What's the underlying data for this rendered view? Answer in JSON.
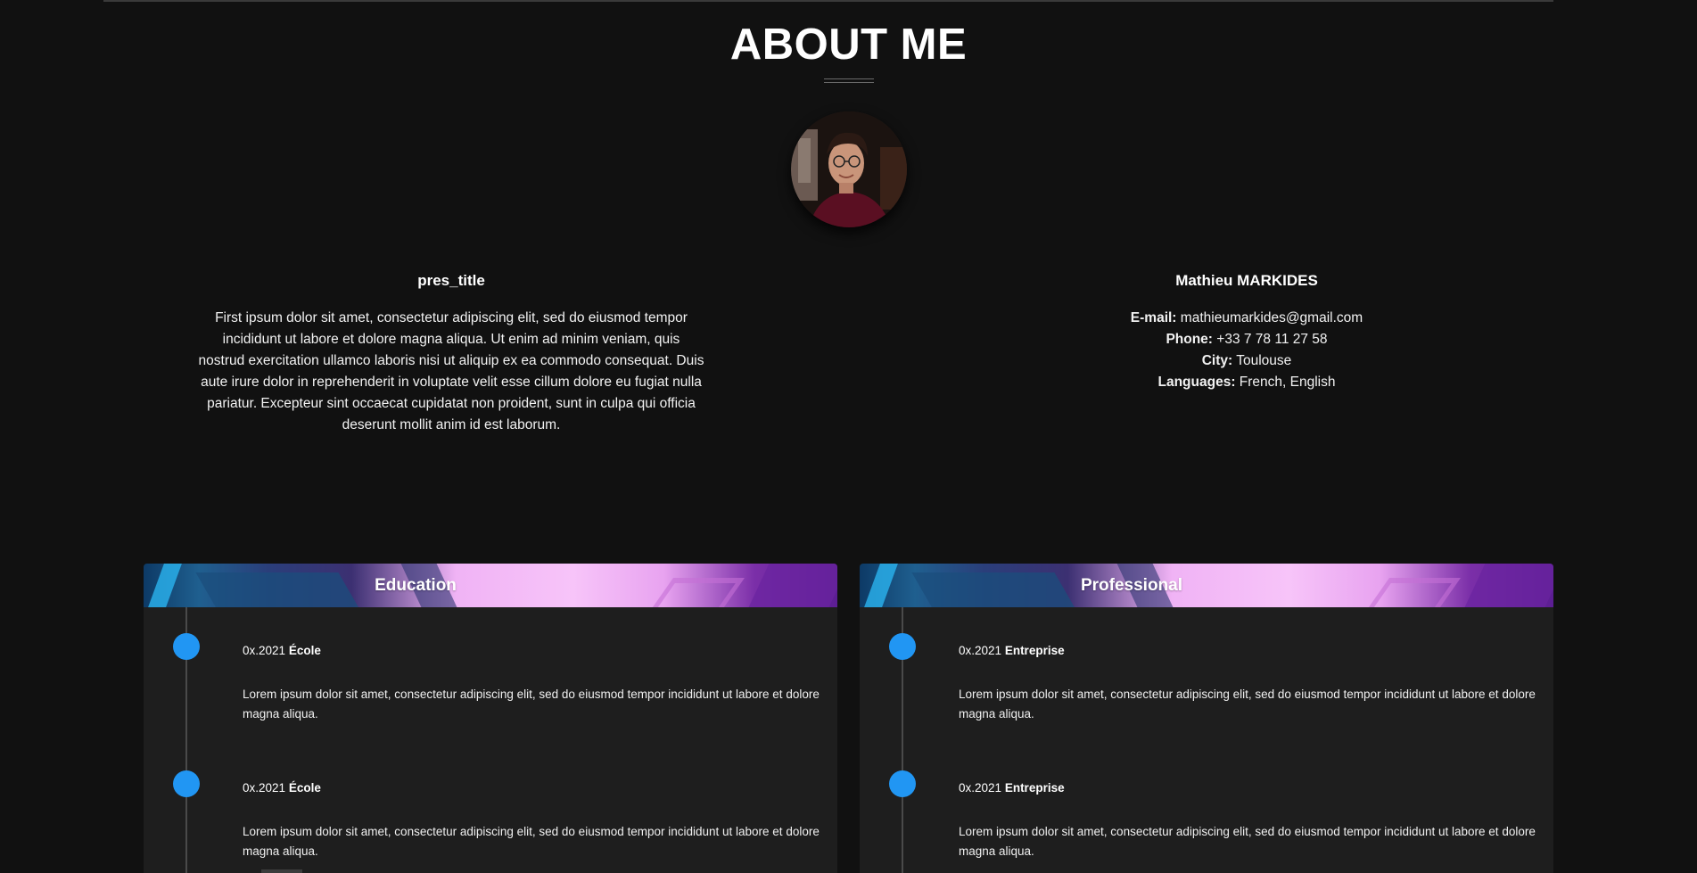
{
  "page": {
    "title": "ABOUT ME"
  },
  "avatar": {
    "icon": "profile-photo"
  },
  "presentation": {
    "title": "pres_title",
    "text": "First ipsum dolor sit amet, consectetur adipiscing elit, sed do eiusmod tempor incididunt ut labore et dolore magna aliqua. Ut enim ad minim veniam, quis nostrud exercitation ullamco laboris nisi ut aliquip ex ea commodo consequat. Duis aute irure dolor in reprehenderit in voluptate velit esse cillum dolore eu fugiat nulla pariatur. Excepteur sint occaecat cupidatat non proident, sunt in culpa qui officia deserunt mollit anim id est laborum."
  },
  "info": {
    "name": "Mathieu MARKIDES",
    "email_label": "E-mail:",
    "email": "mathieumarkides@gmail.com",
    "phone_label": "Phone:",
    "phone": "+33 7 78 11 27 58",
    "city_label": "City:",
    "city": "Toulouse",
    "languages_label": "Languages:",
    "languages": "French, English"
  },
  "education": {
    "title": "Education",
    "entries": [
      {
        "date": "0x.2021",
        "place": "École",
        "description": "Lorem ipsum dolor sit amet, consectetur adipiscing elit, sed do eiusmod tempor incididunt ut labore et dolore magna aliqua."
      },
      {
        "date": "0x.2021",
        "place": "École",
        "description": "Lorem ipsum dolor sit amet, consectetur adipiscing elit, sed do eiusmod tempor incididunt ut labore et dolore magna aliqua."
      }
    ]
  },
  "professional": {
    "title": "Professional",
    "entries": [
      {
        "date": "0x.2021",
        "place": "Entreprise",
        "description": "Lorem ipsum dolor sit amet, consectetur adipiscing elit, sed do eiusmod tempor incididunt ut labore et dolore magna aliqua."
      },
      {
        "date": "0x.2021",
        "place": "Entreprise",
        "description": "Lorem ipsum dolor sit amet, consectetur adipiscing elit, sed do eiusmod tempor incididunt ut labore et dolore magna aliqua."
      }
    ]
  },
  "colors": {
    "background": "#111111",
    "card": "#1e1e1e",
    "accent_dot": "#2196f3"
  }
}
